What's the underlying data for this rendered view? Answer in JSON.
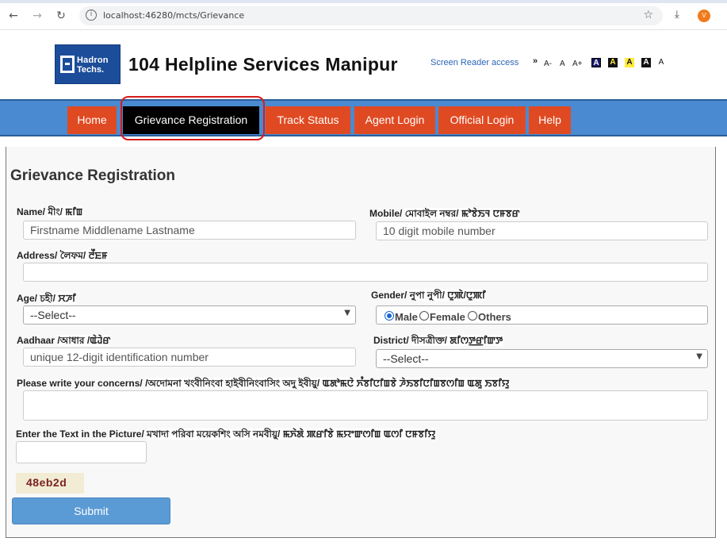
{
  "browser": {
    "back_glyph": "←",
    "forward_glyph": "→",
    "reload_glyph": "↻",
    "info_glyph": "i",
    "url": "localhost:46280/mcts/Grievance",
    "star_glyph": "☆",
    "download_glyph": "⤓",
    "avatar_initial": "V"
  },
  "header": {
    "logo_line1": "Hadron",
    "logo_line2": "Techs.",
    "title": "104 Helpline Services Manipur",
    "screen_reader": "Screen Reader access",
    "sr_arrow": "»",
    "font_small": "A-",
    "font_normal": "A",
    "font_large": "A+",
    "contrast_labels": [
      "A",
      "A",
      "A",
      "A",
      "A"
    ]
  },
  "nav": {
    "items": [
      {
        "label": "Home"
      },
      {
        "label": "Grievance Registration"
      },
      {
        "label": "Track Status"
      },
      {
        "label": "Agent Login"
      },
      {
        "label": "Official Login"
      },
      {
        "label": "Help"
      }
    ],
    "active": "Grievance Registration"
  },
  "form": {
    "title": "Grievance Registration",
    "name_label": "Name/",
    "name_alt": "মীং/ ꯃꯤꯡ",
    "name_placeholder": "Firstname  Middlename  Lastname",
    "mobile_label": "Mobile/",
    "mobile_alt": "মোবাইল নম্বর/ ꯃꯣꯕꯥꯏꯜ ꯅꯝꯕꯔ",
    "mobile_placeholder": "10 digit mobile number",
    "address_label": "Address/",
    "address_alt": "লৈফম/ ꯂꯩꯐꯝ",
    "address_value": "",
    "age_label": "Age/",
    "age_alt": "চহী/ ꯆꯍꯤ",
    "age_select": "--Select--",
    "gender_label": "Gender/",
    "gender_alt": "নুপা নুপী/ ꯅꯨꯄꯥ/ꯅꯨꯄꯤ",
    "gender_options": [
      "Male",
      "Female",
      "Others"
    ],
    "gender_selected": "Male",
    "aadhaar_label": "Aadhaar",
    "aadhaar_alt": "/আধার /ꯑꯥꯙꯥꯔ",
    "aadhaar_placeholder": "unique 12-digit identification number",
    "district_label": "District/",
    "district_alt": "দীসত্ৰীক্ত/ ꯗꯤꯁꯇ꯭ꯔꯤꯛꯇ",
    "district_select": "--Select--",
    "concerns_label": "Please write your concerns/",
    "concerns_alt": "/অদোমনা খংবীনিংবা হাইবীনিংবাসিং অদু ইবীয়ু/ ꯑꯗꯣꯃꯅꯥ ꯈꯪꯕꯤꯅꯤꯡꯕꯥ ꯍꯥꯏꯕꯤꯅꯤꯡꯕꯁꯤꯡ ꯑꯗꯨ ꯏꯕꯤꯌꯨ",
    "concerns_value": "",
    "captcha_label": "Enter the Text in the Picture/",
    "captcha_alt": "মখাদা পরিবা ময়েকশিং অসি নমবীয়ু/ ꯃꯈꯥꯗꯥ ꯄꯔꯤꯕꯥ ꯃꯌꯦꯛꯁꯤꯡ ꯑꯁꯤ ꯅꯝꯕꯤꯌꯨ",
    "captcha_input_value": "",
    "captcha_text": "48eb2d",
    "submit_label": "Submit"
  },
  "colors": {
    "nav_bg": "#4a8ad0",
    "nav_item": "#e04a22",
    "nav_active": "#000000",
    "highlight": "#d81b1b",
    "submit": "#5b9bd5"
  }
}
